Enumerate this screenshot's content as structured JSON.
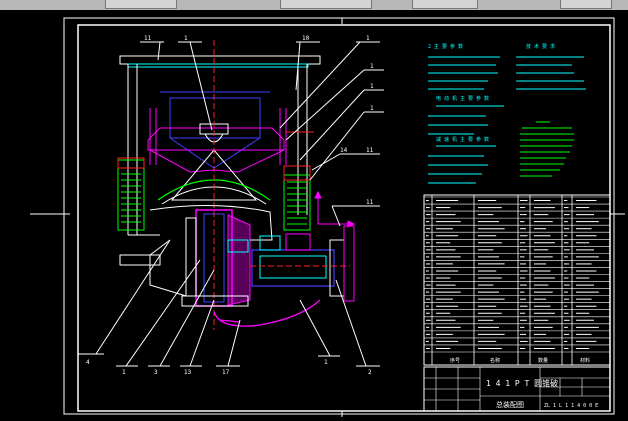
{
  "drawing": {
    "title_block_name": "1 4 1 P T 圆锥破",
    "title_block_sub": "总装配图",
    "drawing_number": "ZL 1 L 1 1 4 0 0 E",
    "table_headers": [
      "序号",
      "名称",
      "数量",
      "材料"
    ],
    "leader_labels_top": [
      "11",
      "1",
      "10",
      "1"
    ],
    "leader_labels_right": [
      "1",
      "1",
      "1",
      "11",
      "14",
      "11"
    ],
    "leader_labels_bottom": [
      "4",
      "1",
      "3",
      "13",
      "17",
      "1",
      "2"
    ],
    "spec_heading_left": "2  主 要 参 数",
    "spec_heading_right": "技 术 要 求",
    "spec_heading_mid1": "电 动 机 主 要 参 数",
    "spec_heading_mid2": "减 速 机 主 要 参 数"
  },
  "colors": {
    "background": "#000000",
    "frame": "#ffffff",
    "cyan": "#00ffff",
    "green": "#00ff00",
    "magenta": "#ff00ff",
    "blue": "#4040ff",
    "red": "#ff2020",
    "yellow": "#ffff00"
  }
}
